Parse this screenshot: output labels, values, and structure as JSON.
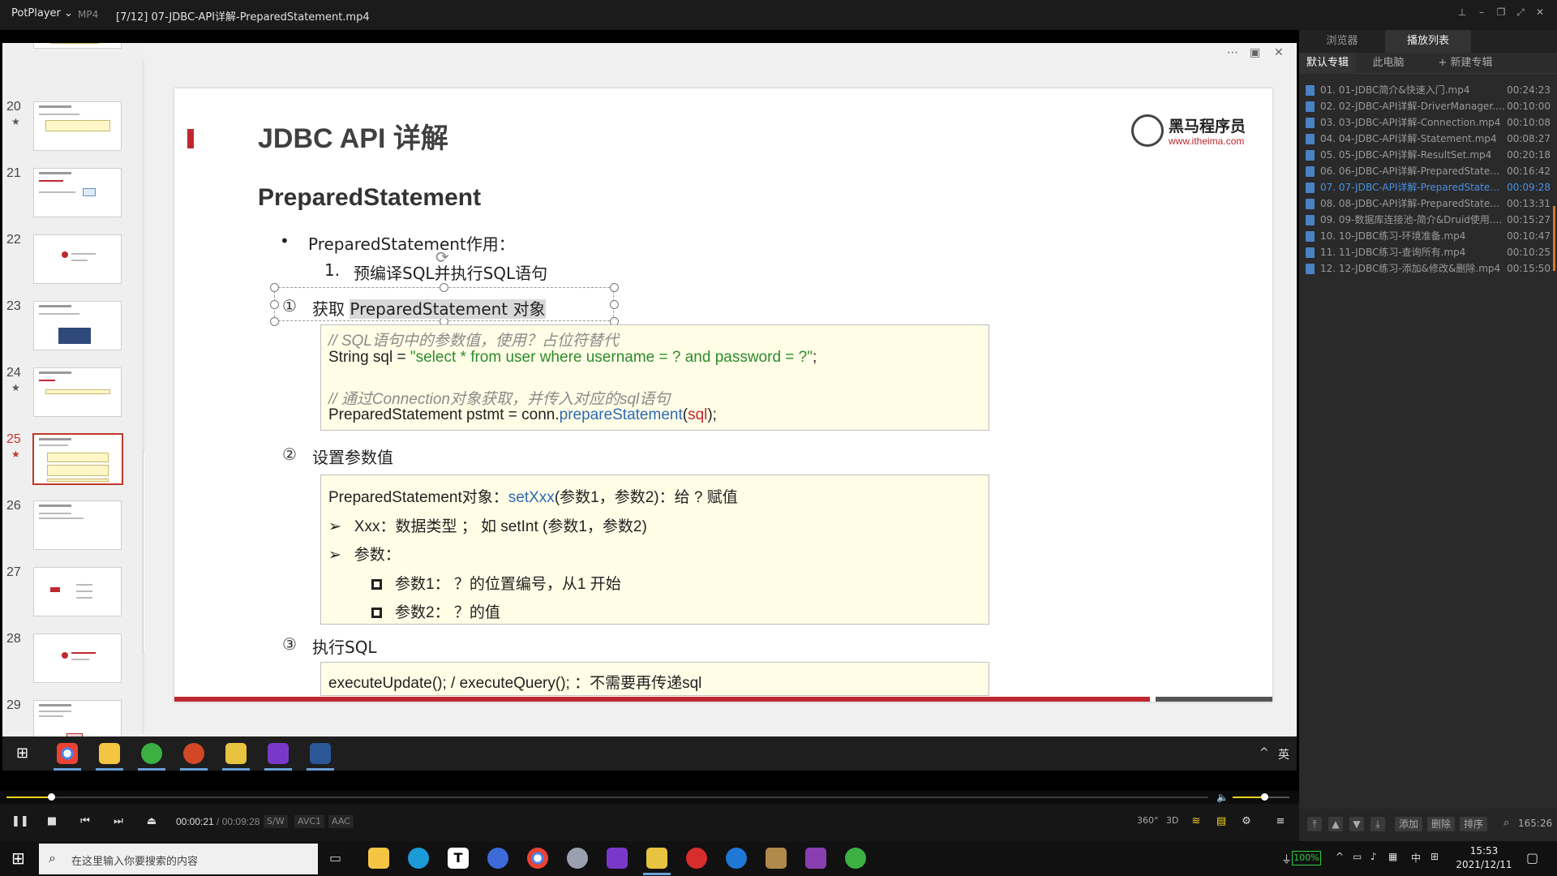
{
  "titlebar": {
    "app": "PotPlayer",
    "format": "MP4",
    "title": "[7/12] 07-JDBC-API详解-PreparedStatement.mp4"
  },
  "thumbnails": [
    {
      "num": "20",
      "star": "★"
    },
    {
      "num": "21",
      "star": ""
    },
    {
      "num": "22",
      "star": ""
    },
    {
      "num": "23",
      "star": ""
    },
    {
      "num": "24",
      "star": "★"
    },
    {
      "num": "25",
      "star": "★"
    },
    {
      "num": "26",
      "star": ""
    },
    {
      "num": "27",
      "star": ""
    },
    {
      "num": "28",
      "star": ""
    },
    {
      "num": "29",
      "star": ""
    }
  ],
  "slide": {
    "title": "JDBC API 详解",
    "logo_cn": "黑马程序员",
    "logo_url": "www.itheima.com",
    "subtitle": "PreparedStatement",
    "bullet": "•",
    "bullet_text": "PreparedStatement作用：",
    "item1_num": "1.",
    "item1_text": "预编译SQL并执行SQL语句",
    "step1_num": "①",
    "step1_pre": "获取",
    "step1_hl": "PreparedStatement 对象",
    "code1": {
      "c1": "// SQL语句中的参数值，使用？占位符替代",
      "l2_a": "String sql = ",
      "l2_b": "\"select * from user where username = ? and password = ?\"",
      "l2_c": ";",
      "c3": "// 通过Connection对象获取，并传入对应的sql语句",
      "l4_a": "PreparedStatement pstmt = conn.",
      "l4_b": "prepareStatement",
      "l4_c": "(",
      "l4_d": "sql",
      "l4_e": ");"
    },
    "step2_num": "②",
    "step2_text": "设置参数值",
    "code2": {
      "l1_a": "PreparedStatement对象：",
      "l1_b": "setXxx",
      "l1_c": "(参数1，参数2)：给 ? 赋值",
      "arrow": "➢",
      "l2": "Xxx：数据类型 ；  如 setInt (参数1，参数2)",
      "l3": "参数：",
      "l4": "参数1：  ？的位置编号，从1 开始",
      "l5": "参数2：  ？的值"
    },
    "step3_num": "③",
    "step3_text": "执行SQL",
    "code3": "executeUpdate(); / executeQuery();  ：不需要再传递sql"
  },
  "vtaskbar": {
    "ime": "英",
    "caret": "^"
  },
  "playlist": {
    "tabs": [
      "浏览器",
      "播放列表"
    ],
    "subtabs": [
      "默认专辑",
      "此电脑",
      "+ 新建专辑"
    ],
    "items": [
      {
        "name": "01. 01-JDBC简介&快速入门.mp4",
        "dur": "00:24:23"
      },
      {
        "name": "02. 02-JDBC-API详解-DriverManager.mp4",
        "dur": "00:10:00"
      },
      {
        "name": "03. 03-JDBC-API详解-Connection.mp4",
        "dur": "00:10:08"
      },
      {
        "name": "04. 04-JDBC-API详解-Statement.mp4",
        "dur": "00:08:27"
      },
      {
        "name": "05. 05-JDBC-API详解-ResultSet.mp4",
        "dur": "00:20:18"
      },
      {
        "name": "06. 06-JDBC-API详解-PreparedStatement-...",
        "dur": "00:16:42"
      },
      {
        "name": "07. 07-JDBC-API详解-PreparedStatement....",
        "dur": "00:09:28"
      },
      {
        "name": "08. 08-JDBC-API详解-PreparedStatement-...",
        "dur": "00:13:31"
      },
      {
        "name": "09. 09-数据库连接池-简介&Druid使用....",
        "dur": "00:15:27"
      },
      {
        "name": "10. 10-JDBC练习-环境准备.mp4",
        "dur": "00:10:47"
      },
      {
        "name": "11. 11-JDBC练习-查询所有.mp4",
        "dur": "00:10:25"
      },
      {
        "name": "12. 12-JDBC练习-添加&修改&删除.mp4",
        "dur": "00:15:50"
      }
    ],
    "current_index": 6,
    "bottom_buttons": [
      "添加",
      "删除",
      "排序"
    ],
    "total": "165:26"
  },
  "player": {
    "time_current": "00:00:21",
    "time_sep": " / ",
    "time_total": "00:09:28",
    "progress": 0.037,
    "volume": 0.55,
    "tags": [
      "S/W",
      "AVC1",
      "AAC"
    ],
    "right_labels": [
      "360°",
      "3D"
    ]
  },
  "host": {
    "search_placeholder": "在这里输入你要搜索的内容",
    "battery": "100%",
    "ime": "中",
    "time": "15:53",
    "date": "2021/12/11"
  },
  "colors": {
    "accent_red": "#c0282f",
    "code_bg": "#fffde6",
    "playlist_current": "#4a90e2",
    "seek_yellow": "#f2d31e"
  }
}
